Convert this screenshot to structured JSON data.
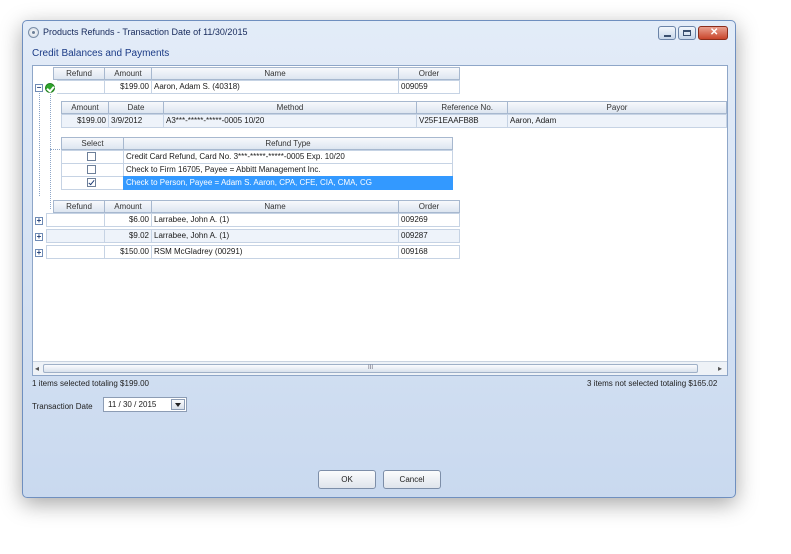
{
  "window": {
    "title": "Products Refunds - Transaction Date of 11/30/2015"
  },
  "section_title": "Credit Balances and Payments",
  "columns": {
    "refund": "Refund",
    "amount": "Amount",
    "name": "Name",
    "order": "Order"
  },
  "top_row": {
    "amount": "$199.00",
    "name": "Aaron, Adam S. (40318)",
    "order": "009059"
  },
  "payment_columns": {
    "amount": "Amount",
    "date": "Date",
    "method": "Method",
    "reference": "Reference No.",
    "payor": "Payor"
  },
  "payment_row": {
    "amount": "$199.00",
    "date": "3/9/2012",
    "method": "A3***-*****-*****-0005 10/20",
    "reference": "V25F1EAAFB8B",
    "payor": "Aaron, Adam"
  },
  "refund_type_columns": {
    "select": "Select",
    "type": "Refund Type"
  },
  "refund_types": [
    {
      "label": "Credit Card Refund, Card No. 3***-*****-*****-0005 Exp. 10/20",
      "checked": false
    },
    {
      "label": "Check to Firm 16705, Payee = Abbitt Management Inc.",
      "checked": false
    },
    {
      "label": "Check to Person, Payee = Adam S. Aaron, CPA, CFE, CIA, CMA, CG",
      "checked": true
    }
  ],
  "other_rows": [
    {
      "amount": "$6.00",
      "name": "Larrabee, John A. (1)",
      "order": "009269"
    },
    {
      "amount": "$9.02",
      "name": "Larrabee, John A. (1)",
      "order": "009287"
    },
    {
      "amount": "$150.00",
      "name": "RSM McGladrey (00291)",
      "order": "009168"
    }
  ],
  "scrollbar": {
    "left": "◂",
    "right": "▸",
    "grip": "III"
  },
  "status": {
    "selected": "1 items selected totaling $199.00",
    "not_selected": "3 items not selected totaling $165.02"
  },
  "transaction_date": {
    "label": "Transaction Date",
    "value": "11 / 30 / 2015"
  },
  "buttons": {
    "ok": "OK",
    "cancel": "Cancel"
  }
}
